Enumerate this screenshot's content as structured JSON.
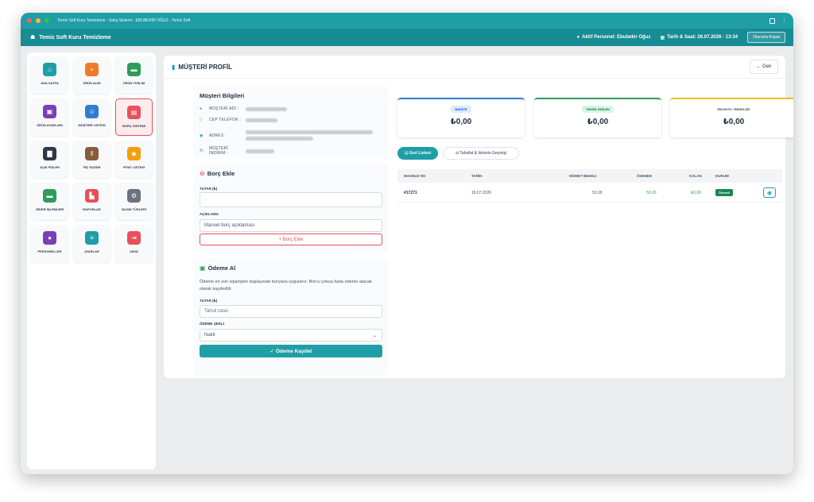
{
  "window": {
    "title": "Temiz Soft Kuru Temizleme - Satış Sistemi - EBUBEKİR OĞUZ - Temiz Soft"
  },
  "appbar": {
    "title": "Temiz Soft Kuru Temizleme",
    "active_staff": "Aktif Personel: Ebubekir Oğuz",
    "datetime": "Tarih & Saat: 26.07.2026 - 13:34",
    "close_session": "Oturumu Kapat"
  },
  "sidebar": {
    "items": [
      {
        "label": "ANA SAYFA",
        "icon": "home-icon",
        "glyph": "⌂",
        "color": "#1f9ea6"
      },
      {
        "label": "ÜRÜN ALIM",
        "icon": "plus-circle-icon",
        "glyph": "+",
        "color": "#f07b2b"
      },
      {
        "label": "ÜRÜN TESLİM",
        "icon": "truck-icon",
        "glyph": "▬",
        "color": "#2e9d5b"
      },
      {
        "label": "ÜRÜN AYARLARI",
        "icon": "box-icon",
        "glyph": "▣",
        "color": "#7b3fb8"
      },
      {
        "label": "MÜŞTERİ LİSTESİ",
        "icon": "users-icon",
        "glyph": "☺",
        "color": "#2f7dd1"
      },
      {
        "label": "BORÇ SİSTEMİ",
        "icon": "wallet-icon",
        "glyph": "▤",
        "color": "#e8505b"
      },
      {
        "label": "AÇIK FİŞLER",
        "icon": "file-icon",
        "glyph": "▇",
        "color": "#2d3748"
      },
      {
        "label": "FİŞ YAZDIR",
        "icon": "barcode-icon",
        "glyph": "‖",
        "color": "#8a5a3c"
      },
      {
        "label": "FİYAT LİSTESİ",
        "icon": "tag-icon",
        "glyph": "◆",
        "color": "#f59e0b"
      },
      {
        "label": "GİDER İŞLEMLERİ",
        "icon": "money-icon",
        "glyph": "▬",
        "color": "#2e9d5b"
      },
      {
        "label": "RAPORLAR",
        "icon": "chart-icon",
        "glyph": "▙",
        "color": "#e8505b"
      },
      {
        "label": "İŞLEM TÜRLERİ",
        "icon": "gears-icon",
        "glyph": "⚙",
        "color": "#6b7280"
      },
      {
        "label": "PERSONELLER",
        "icon": "person-icon",
        "glyph": "●",
        "color": "#7b3fb8"
      },
      {
        "label": "AYARLAR",
        "icon": "sliders-icon",
        "glyph": "≡",
        "color": "#1f9ea6"
      },
      {
        "label": "ÇIKIŞ",
        "icon": "logout-icon",
        "glyph": "⇥",
        "color": "#e8505b"
      }
    ]
  },
  "page": {
    "title": "MÜŞTERİ PROFİL",
    "back": "← Geri"
  },
  "customer": {
    "section_title": "Müşteri Bilgileri",
    "name_label": "MÜŞTERİ ADI :",
    "phone_label": "CEP TELEFON :",
    "address_label": "ADRES :",
    "discount_label": "MÜŞTERİ İNDİRİM :"
  },
  "debt": {
    "section_title": "Borç Ekle",
    "amount_label": "TUTAR (₺)",
    "amount_value": "",
    "desc_label": "AÇIKLAMA",
    "desc_value": "Manuel borç açıklaması",
    "add_button": "+ Borç Ekle"
  },
  "payment": {
    "section_title": "Ödeme Al",
    "help": "Ödeme en son siparişten başlayarak borçlara uygulanır. Borcu yoksa fazla ödeme alacak olarak kaydedilir.",
    "amount_label": "TUTAR (₺)",
    "amount_placeholder": "Tahsil tutarı",
    "method_label": "ÖDEME ŞEKLİ",
    "method_value": "Nakit",
    "save_button": "✓ Ödeme Kaydet"
  },
  "stats": [
    {
      "label": "BAKİYE",
      "value": "₺0,00",
      "color": "#2f7dd1",
      "badge_bg": "#dbeafe",
      "badge_fg": "#1d4ed8"
    },
    {
      "label": "TAHSİL EDİLEN",
      "value": "₺0,00",
      "color": "#2e9d5b",
      "badge_bg": "#d1fae5",
      "badge_fg": "#166534"
    },
    {
      "label": "İSKONTO / BEDELSİZ",
      "value": "₺0,00",
      "color": "#e6c229",
      "badge_bg": "#ffffff",
      "badge_fg": "#374151"
    }
  ],
  "tabs": [
    {
      "label": "▤ Geri Listesi"
    },
    {
      "label": "⇄ Tahsilat & İskonto Geçmişi"
    }
  ],
  "table": {
    "columns": [
      "MAKBUZ NO",
      "TARİH",
      "HİZMET BEDELİ",
      "ÖDENEN",
      "KALAN",
      "DURUM"
    ],
    "rows": [
      {
        "receipt": "#17271",
        "date": "18.07.2026",
        "fee": "53.00",
        "paid": "53.00",
        "remaining": "₺0,00",
        "status": "Ödendi"
      }
    ]
  }
}
